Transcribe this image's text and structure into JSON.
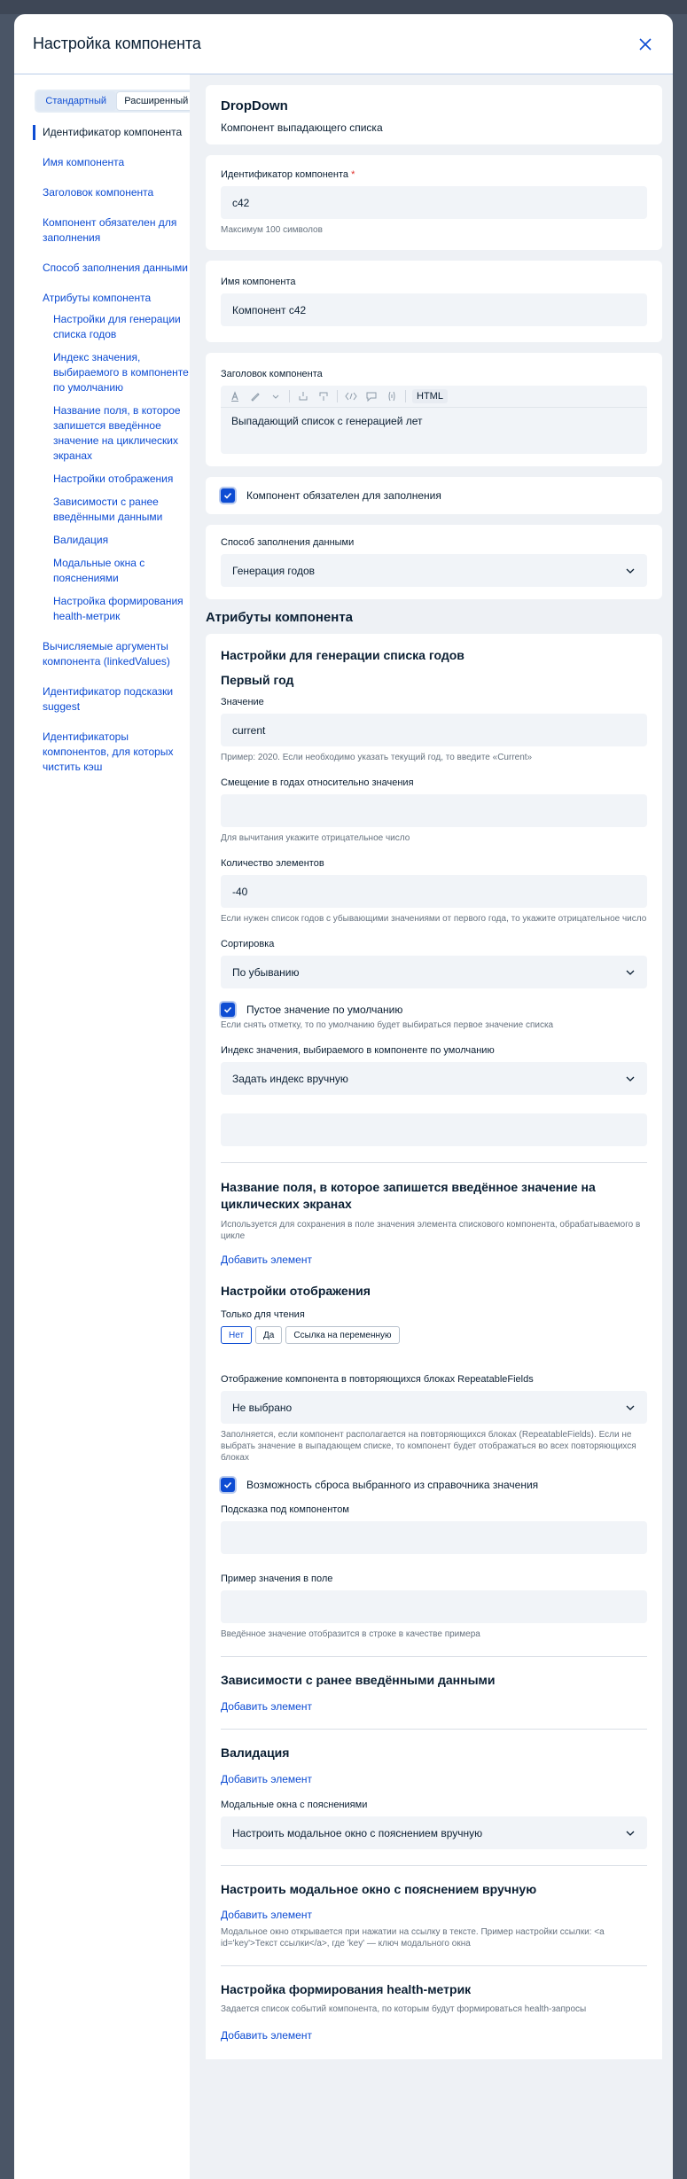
{
  "modal": {
    "title": "Настройка компонента"
  },
  "mode": {
    "standard": "Стандартный",
    "extended": "Расширенный"
  },
  "nav": {
    "items": [
      {
        "label": "Идентификатор компонента"
      },
      {
        "label": "Имя компонента"
      },
      {
        "label": "Заголовок компонента"
      },
      {
        "label": "Компонент обязателен для заполнения"
      },
      {
        "label": "Способ заполнения данными"
      },
      {
        "label": "Атрибуты компонента"
      },
      {
        "label": "Настройки для генерации списка годов"
      },
      {
        "label": "Индекс значения, выбираемого в компоненте по умолчанию"
      },
      {
        "label": "Название поля, в которое запишется введённое значение на циклических экранах"
      },
      {
        "label": "Настройки отображения"
      },
      {
        "label": "Зависимости с ранее введёнными данными"
      },
      {
        "label": "Валидация"
      },
      {
        "label": "Модальные окна с пояснениями"
      },
      {
        "label": "Настройка формирования health-метрик"
      },
      {
        "label": "Вычисляемые аргументы компонента (linkedValues)"
      },
      {
        "label": "Идентификатор подсказки suggest"
      },
      {
        "label": "Идентификаторы компонентов, для которых чистить кэш"
      }
    ]
  },
  "component": {
    "type": "DropDown",
    "description": "Компонент выпадающего списка"
  },
  "id_field": {
    "label": "Идентификатор компонента",
    "required_mark": "*",
    "value": "c42",
    "hint": "Максимум 100 символов"
  },
  "name_field": {
    "label": "Имя компонента",
    "value": "Компонент с42"
  },
  "title_field": {
    "label": "Заголовок компонента",
    "toolbar_html": "HTML",
    "value": "Выпадающий список с генерацией лет"
  },
  "required": {
    "label": "Компонент обязателен для заполнения"
  },
  "fill_method": {
    "label": "Способ заполнения данными",
    "value": "Генерация годов"
  },
  "attributes": {
    "title": "Атрибуты компонента",
    "years_title": "Настройки для генерации списка годов",
    "first_year": "Первый год",
    "value_label": "Значение",
    "value": "current",
    "value_hint": "Пример: 2020. Если необходимо указать текущий год, то введите «Current»",
    "offset_label": "Смещение в годах относительно значения",
    "offset_hint": "Для вычитания укажите отрицательное число",
    "count_label": "Количество элементов",
    "count_value": "-40",
    "count_hint": "Если нужен список годов с убывающими значениями от первого года, то укажите отрицательное число",
    "sort_label": "Сортировка",
    "sort_value": "По убыванию",
    "empty_default_label": "Пустое значение по умолчанию",
    "empty_default_hint": "Если снять отметку, то по умолчанию будет выбираться первое значение списка",
    "index_label": "Индекс значения, выбираемого в компоненте по умолчанию",
    "index_value": "Задать индекс вручную"
  },
  "cyclic": {
    "title": "Название поля, в которое запишется введённое значение на циклических экранах",
    "hint": "Используется для сохранения в поле значения элемента спискового компонента, обрабатываемого в цикле",
    "add": "Добавить элемент"
  },
  "display": {
    "title": "Настройки отображения",
    "readonly_label": "Только для чтения",
    "readonly_options": [
      "Нет",
      "Да",
      "Ссылка на переменную"
    ],
    "repeatable_label": "Отображение компонента в повторяющихся блоках RepeatableFields",
    "repeatable_value": "Не выбрано",
    "repeatable_hint": "Заполняется, если компонент располагается на повторяющихся блоках (RepeatableFields). Если не выбрать значение в выпадающем списке, то компонент будет отображаться во всех повторяющихся блоках",
    "reset_label": "Возможность сброса выбранного из справочника значения",
    "tooltip_label": "Подсказка под компонентом",
    "example_label": "Пример значения в поле",
    "example_hint": "Введённое значение отобразится в строке в качестве примера"
  },
  "dependencies": {
    "title": "Зависимости с ранее введёнными данными",
    "add": "Добавить элемент"
  },
  "validation": {
    "title": "Валидация",
    "add": "Добавить элемент",
    "modal_label": "Модальные окна с пояснениями",
    "modal_value": "Настроить модальное окно с пояснением вручную"
  },
  "manual_modal": {
    "title": "Настроить модальное окно с пояснением вручную",
    "add": "Добавить элемент",
    "hint": "Модальное окно открывается при нажатии на ссылку в тексте. Пример настройки ссылки: <a id='key'>Текст ссылки</a>, где 'key' — ключ модального окна"
  },
  "health": {
    "title": "Настройка формирования health-метрик",
    "hint": "Задается список событий компонента, по которым будут формироваться health-запросы",
    "add": "Добавить элемент"
  },
  "colors": {
    "accent": "#0d4cd3",
    "backdrop": "#4a5566",
    "panel": "#eef1f5"
  },
  "icons": [
    "close-icon",
    "chevron-down-icon",
    "check-icon",
    "text-color-icon",
    "highlight-icon",
    "code-icon",
    "comment-icon"
  ]
}
